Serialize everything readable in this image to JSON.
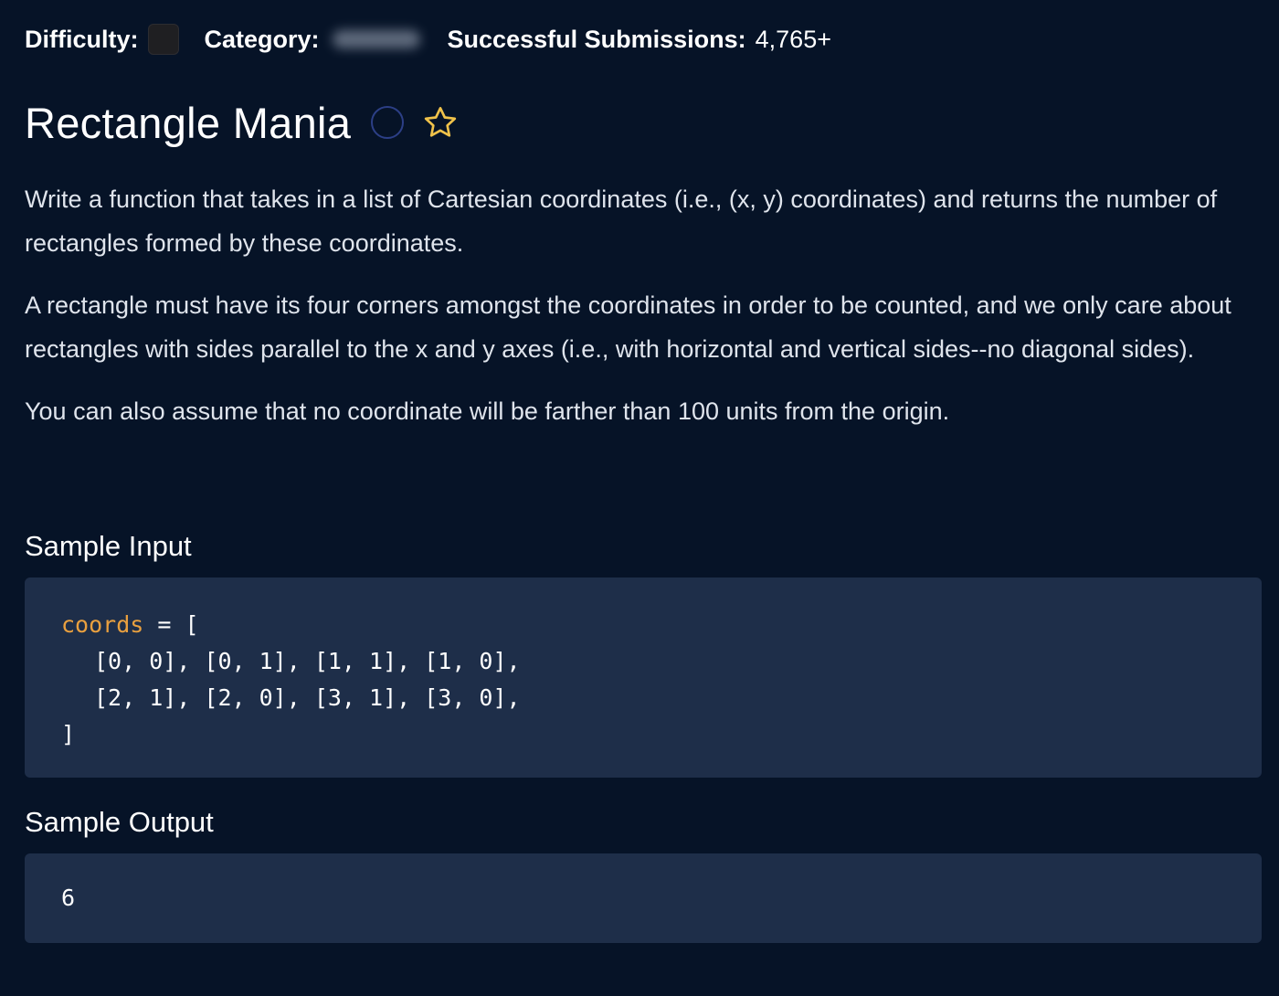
{
  "meta": {
    "difficulty_label": "Difficulty:",
    "category_label": "Category:",
    "submissions_label": "Successful Submissions:",
    "submissions_value": "4,765+"
  },
  "problem": {
    "title": "Rectangle Mania",
    "paragraphs": [
      "Write a function that takes in a list of Cartesian coordinates (i.e., (x, y) coordinates) and returns the number of rectangles formed by these coordinates.",
      "A rectangle must have its four corners amongst the coordinates in order to be counted, and we only care about rectangles with sides parallel to the x and y axes (i.e., with horizontal and vertical sides--no diagonal sides).",
      "You can also assume that no coordinate will be farther than 100 units from the origin."
    ]
  },
  "sample_input": {
    "heading": "Sample Input",
    "var_name": "coords",
    "assign": " = [",
    "lines": [
      "[0, 0], [0, 1], [1, 1], [1, 0],",
      "[2, 1], [2, 0], [3, 1], [3, 0],"
    ],
    "closing": "]"
  },
  "sample_output": {
    "heading": "Sample Output",
    "value": "6"
  },
  "icons": {
    "status": "status-circle-icon",
    "favorite": "star-icon"
  },
  "colors": {
    "background": "#061327",
    "code_background": "#1e2e49",
    "code_variable": "#e9a03f",
    "star": "#f0c24a",
    "status_ring": "#2c3f86"
  }
}
